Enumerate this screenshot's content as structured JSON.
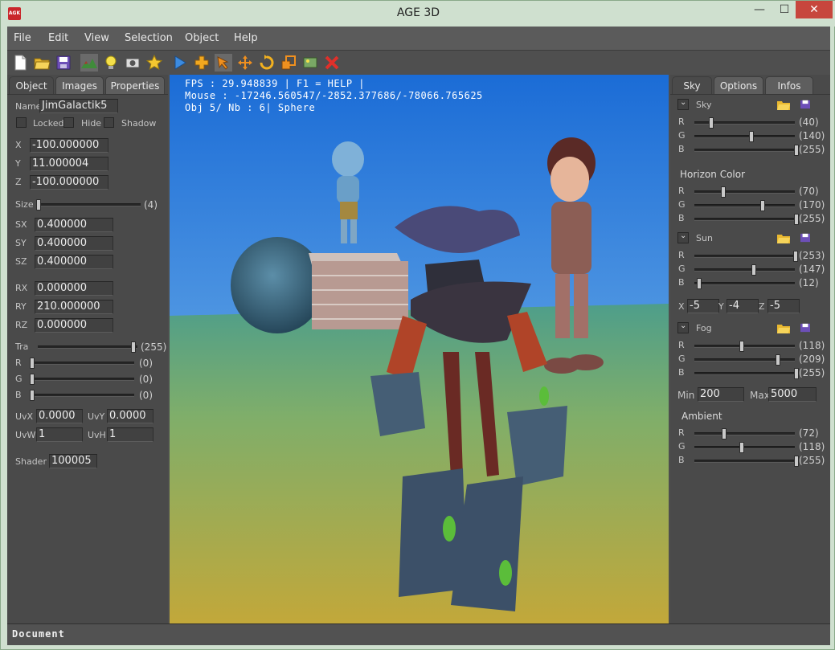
{
  "window": {
    "title": "AGE 3D",
    "icon_text": "AGK",
    "minimize": "—",
    "maximize": "☐",
    "close": "✕"
  },
  "menu": [
    "File",
    "Edit",
    "View",
    "Selection",
    "Object",
    "Help"
  ],
  "toolbar": [
    "new-file-icon",
    "open-folder-icon",
    "save-icon",
    "terrain-icon",
    "light-bulb-icon",
    "camera-icon",
    "star-icon",
    "play-icon",
    "add-object-icon",
    "select-arrow-icon",
    "move-icon",
    "rotate-icon",
    "scale-icon",
    "image-icon",
    "delete-icon"
  ],
  "left": {
    "tabs": [
      "Object",
      "Images",
      "Properties"
    ],
    "name_label": "Name",
    "name_value": "JimGalactik5",
    "locked": "Locked",
    "hide": "Hide",
    "shadow": "Shadow",
    "x_label": "X",
    "x_value": "-100.000000",
    "y_label": "Y",
    "y_value": "11.000004",
    "z_label": "Z",
    "z_value": "-100.000000",
    "size_label": "Size",
    "size_value": "(4)",
    "size_level": 0.0,
    "sx_label": "SX",
    "sx_value": "0.400000",
    "sy_label": "SY",
    "sy_value": "0.400000",
    "sz_label": "SZ",
    "sz_value": "0.400000",
    "rx_label": "RX",
    "rx_value": "0.000000",
    "ry_label": "RY",
    "ry_value": "210.000000",
    "rz_label": "RZ",
    "rz_value": "0.000000",
    "tra_label": "Tra",
    "tra_value": "(255)",
    "r_label": "R",
    "r_value": "(0)",
    "g_label": "G",
    "g_value": "(0)",
    "b_label": "B",
    "b_value": "(0)",
    "uvx_label": "UvX",
    "uvx_value": "0.0000",
    "uvy_label": "UvY",
    "uvy_value": "0.0000",
    "uvw_label": "UvW",
    "uvw_value": "1",
    "uvh_label": "UvH",
    "uvh_value": "1",
    "shader_label": "Shader",
    "shader_value": "100005"
  },
  "viewport": {
    "hud_line1": "FPS : 29.948839 | F1 = HELP |",
    "hud_line2": "Mouse : -17246.560547/-2852.377686/-78066.765625",
    "hud_line3": "Obj 5/ Nb : 6| Sphere"
  },
  "right": {
    "tabs": [
      "Sky",
      "Options",
      "Infos"
    ],
    "sky_label": "Sky",
    "sky_r": "(40)",
    "sky_g": "(140)",
    "sky_b": "(255)",
    "horizon_title": "Horizon  Color",
    "hor_r": "(70)",
    "hor_g": "(170)",
    "hor_b": "(255)",
    "sun_label": "Sun",
    "sun_r": "(253)",
    "sun_g": "(147)",
    "sun_b": "(12)",
    "x_label": "X",
    "x_value": "-5",
    "y_label": "Y",
    "y_value": "-4",
    "z_label": "Z",
    "z_value": "-5",
    "fog_label": "Fog",
    "fog_r": "(118)",
    "fog_g": "(209)",
    "fog_b": "(255)",
    "min_label": "Min",
    "min_value": "200",
    "max_label": "Max",
    "max_value": "5000",
    "ambient_title": "Ambient",
    "amb_r": "(72)",
    "amb_g": "(118)",
    "amb_b": "(255)",
    "rgb": [
      "R",
      "G",
      "B"
    ]
  },
  "status": {
    "text": "Document"
  },
  "colors": {
    "panel": "#4a4a4a",
    "sky_top": "#1e6fd8",
    "ground": "#b9a33c",
    "close": "#c7463d"
  }
}
